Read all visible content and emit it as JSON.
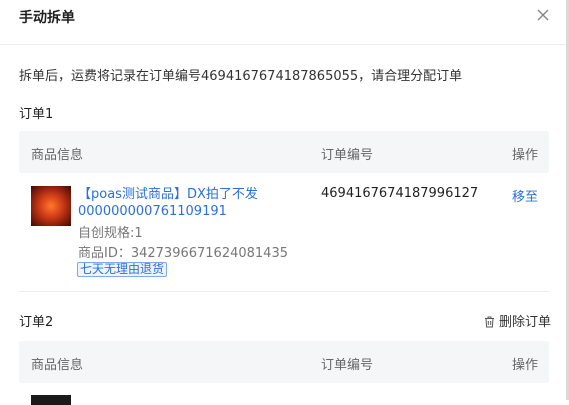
{
  "dialog": {
    "title": "手动拆单",
    "tip": "拆单后，运费将记录在订单编号4694167674187865055，请合理分配订单"
  },
  "table_headers": {
    "product": "商品信息",
    "order_no": "订单编号",
    "action": "操作"
  },
  "orders": [
    {
      "title": "订单1",
      "item": {
        "name": "【poas测试商品】DX拍了不发000000000761109191",
        "spec": "自创规格:1",
        "product_id": "商品ID：3427396671624081435",
        "badge": "七天无理由退货",
        "order_no": "4694167674187996127",
        "action": "移至"
      }
    },
    {
      "title": "订单2",
      "delete_label": "删除订单"
    }
  ],
  "colors": {
    "link": "#2b6fd8",
    "header_bg": "#f5f6f8"
  }
}
